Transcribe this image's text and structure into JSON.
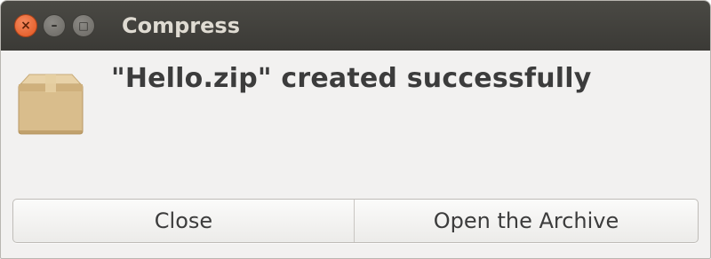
{
  "window": {
    "title": "Compress",
    "controls": {
      "close_glyph": "×",
      "minimize_glyph": "–",
      "maximize_glyph": "□"
    }
  },
  "dialog": {
    "icon": "archive-box-icon",
    "message": "\"Hello.zip\" created successfully"
  },
  "buttons": {
    "close_label": "Close",
    "open_label": "Open the Archive"
  }
}
